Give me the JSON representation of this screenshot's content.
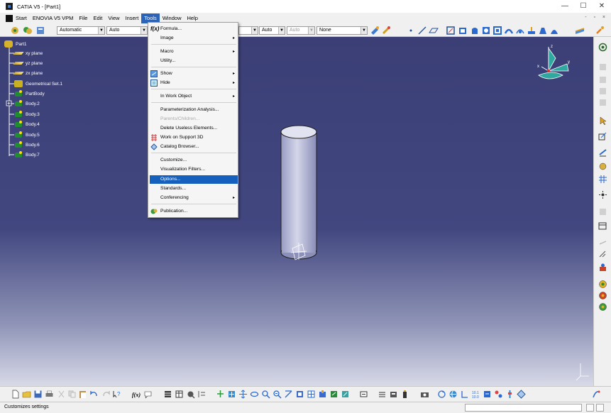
{
  "window": {
    "title": "CATIA V5 - [Part1]",
    "minimize": "—",
    "maximize": "☐",
    "close": "✕",
    "mdi_controls": "- ▫ ×"
  },
  "menubar": {
    "items": [
      "Start",
      "ENOVIA V5 VPM",
      "File",
      "Edit",
      "View",
      "Insert",
      "Tools",
      "Window",
      "Help"
    ],
    "active": "Tools"
  },
  "toolbar": {
    "combo_color": "Automatic",
    "combo_auto1": "Auto",
    "combo_auto2": "Auto",
    "combo_auto3": "Auto",
    "combo_none": "None"
  },
  "tree": {
    "nodes": [
      {
        "label": "Part1",
        "icon": "part-icon"
      },
      {
        "label": "xy plane",
        "icon": "plane-icon"
      },
      {
        "label": "yz plane",
        "icon": "plane-icon"
      },
      {
        "label": "zx plane",
        "icon": "plane-icon"
      },
      {
        "label": "Geometrical Set.1",
        "icon": "geometrical-set-icon"
      },
      {
        "label": "PartBody",
        "icon": "body-icon"
      },
      {
        "label": "Body.2",
        "icon": "body-icon"
      },
      {
        "label": "Body.3",
        "icon": "body-icon"
      },
      {
        "label": "Body.4",
        "icon": "body-icon"
      },
      {
        "label": "Body.5",
        "icon": "body-icon"
      },
      {
        "label": "Body.6",
        "icon": "body-icon"
      },
      {
        "label": "Body.7",
        "icon": "body-icon"
      }
    ]
  },
  "tools_menu": {
    "items": [
      {
        "label": "Formula...",
        "icon": "formula-icon"
      },
      {
        "label": "Image",
        "submenu": true
      },
      {
        "label": "Macro",
        "submenu": true
      },
      {
        "label": "Utility..."
      },
      {
        "label": "Show",
        "submenu": true,
        "icon": "show-icon"
      },
      {
        "label": "Hide",
        "submenu": true,
        "icon": "hide-icon"
      },
      {
        "label": "In Work Object",
        "submenu": true
      },
      {
        "label": "Parameterization Analysis..."
      },
      {
        "label": "Parents/Children...",
        "disabled": true
      },
      {
        "label": "Delete Useless Elements..."
      },
      {
        "label": "Work on Support 3D",
        "icon": "work-support-icon"
      },
      {
        "label": "Catalog Browser...",
        "icon": "catalog-icon"
      },
      {
        "label": "Customize..."
      },
      {
        "label": "Visualization Filters..."
      },
      {
        "label": "Options...",
        "highlighted": true
      },
      {
        "label": "Standards..."
      },
      {
        "label": "Conferencing",
        "submenu": true
      },
      {
        "label": "Publication...",
        "icon": "publication-icon"
      }
    ],
    "submenu_arrow": "▸"
  },
  "compass": {
    "x_label": "x",
    "y_label": "y",
    "z_label": "z"
  },
  "status": {
    "text": "Customizes settings"
  },
  "colors": {
    "viewport_top": "#3b3f76",
    "viewport_bottom": "#d8dae8",
    "menu_highlight": "#1560bd",
    "cylinder": "#c7c9e2"
  }
}
